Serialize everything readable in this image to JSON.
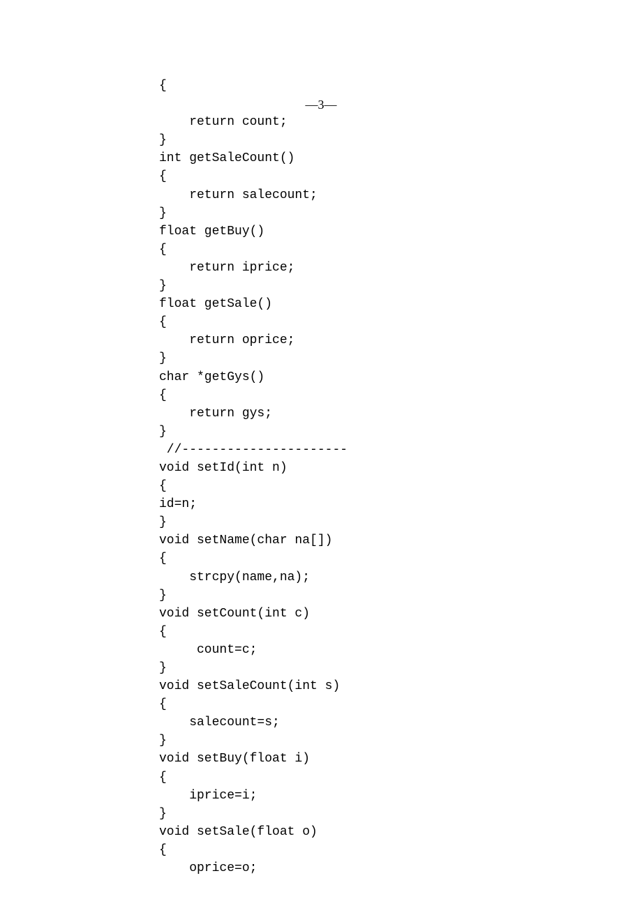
{
  "page_number": "—3—",
  "code": {
    "lines": [
      "{",
      "",
      "    return count;",
      "}",
      "int getSaleCount()",
      "{",
      "    return salecount;",
      "}",
      "float getBuy()",
      "{",
      "    return iprice;",
      "}",
      "float getSale()",
      "{",
      "    return oprice;",
      "}",
      "char *getGys()",
      "{",
      "    return gys;",
      "}",
      " //----------------------",
      "void setId(int n)",
      "{",
      "id=n;",
      "}",
      "void setName(char na[])",
      "{",
      "    strcpy(name,na);",
      "}",
      "void setCount(int c)",
      "{",
      "     count=c;",
      "}",
      "void setSaleCount(int s)",
      "{",
      "    salecount=s;",
      "}",
      "void setBuy(float i)",
      "{",
      "    iprice=i;",
      "}",
      "void setSale(float o)",
      "{",
      "    oprice=o;"
    ]
  }
}
